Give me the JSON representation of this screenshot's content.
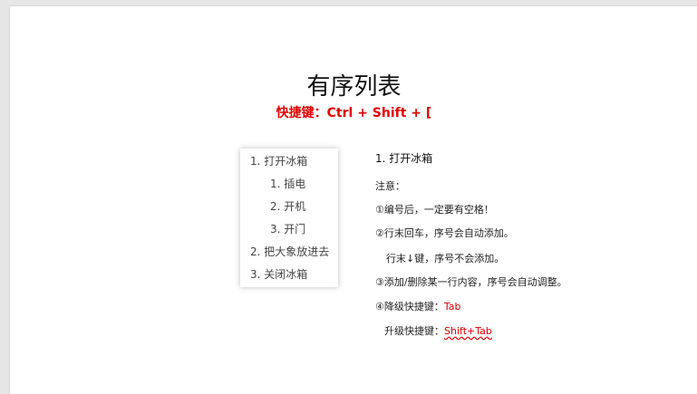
{
  "slide": {
    "title": "有序列表",
    "shortcut": "快捷键：Ctrl + Shift + ["
  },
  "example_list": {
    "items": [
      {
        "label": "1. 打开冰箱"
      },
      {
        "label": "1. 插电"
      },
      {
        "label": "2. 开机"
      },
      {
        "label": "3. 开门"
      },
      {
        "label": "2. 把大象放进去"
      },
      {
        "label": "3. 关闭冰箱"
      }
    ]
  },
  "notes": {
    "heading": "1. 打开冰箱",
    "intro": "注意：",
    "line1": "①编号后，一定要有空格！",
    "line2": "②行末回车，序号会自动添加。",
    "line3": "行末↓键，序号不会添加。",
    "line4": "③添加/删除某一行内容，序号会自动调整。",
    "line5_prefix": "④降级快捷键：",
    "line5_key": "Tab",
    "line6_prefix": "升级快捷键：",
    "line6_key": "Shift+Tab"
  },
  "colors": {
    "accent_red": "#e00000",
    "canvas_bg": "#e6e6e6",
    "slide_bg": "#ffffff"
  }
}
